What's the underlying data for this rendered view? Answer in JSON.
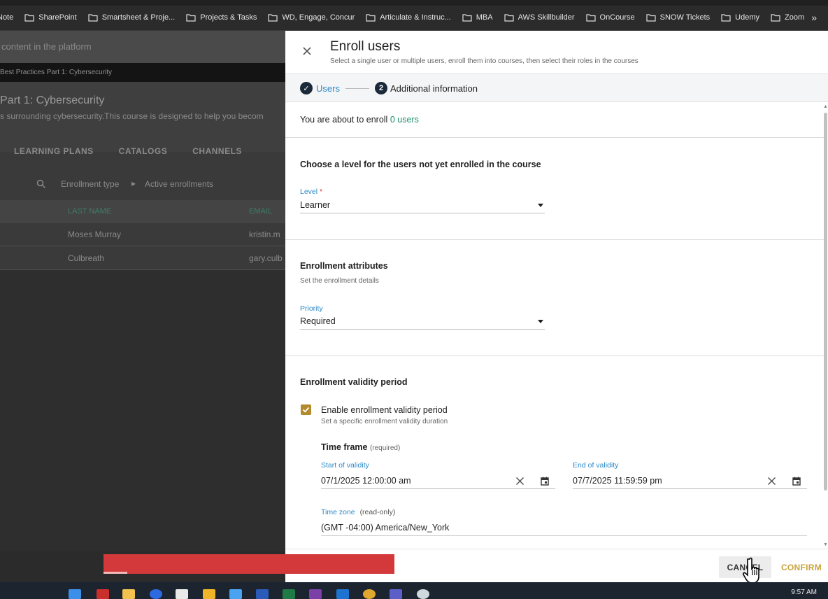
{
  "bookmarks": [
    {
      "label": "Note"
    },
    {
      "label": "SharePoint"
    },
    {
      "label": "Smartsheet & Proje..."
    },
    {
      "label": "Projects & Tasks"
    },
    {
      "label": "WD, Engage, Concur"
    },
    {
      "label": "Articulate & Instruc..."
    },
    {
      "label": "MBA"
    },
    {
      "label": "AWS Skillbuilder"
    },
    {
      "label": "OnCourse"
    },
    {
      "label": "SNOW Tickets"
    },
    {
      "label": "Udemy"
    },
    {
      "label": "Zoom"
    }
  ],
  "bookmarks_more": "»",
  "background": {
    "search_hint": "content in the platform",
    "breadcrumb": "Best Practices Part 1: Cybersecurity",
    "course_title": "Part 1: Cybersecurity",
    "course_desc": "s surrounding cybersecurity.This course is designed to help you becom",
    "tabs": [
      "LEARNING PLANS",
      "CATALOGS",
      "CHANNELS"
    ],
    "filter_type": "Enrollment type",
    "filter_arrow": "▸",
    "filter_value": "Active enrollments",
    "columns": [
      "LAST NAME",
      "EMAIL"
    ],
    "rows": [
      {
        "last_name": "Moses Murray",
        "email": "kristin.m"
      },
      {
        "last_name": "Culbreath",
        "email": "gary.culb"
      }
    ]
  },
  "panel": {
    "title": "Enroll users",
    "subtitle": "Select a single user or multiple users, enroll them into courses, then select their roles in the courses",
    "steps": [
      {
        "number": "✓",
        "label": "Users"
      },
      {
        "number": "2",
        "label": "Additional information"
      }
    ],
    "enroll_prefix": "You are about to enroll",
    "enroll_count": "0 users",
    "level_section_title": "Choose a level for the users not yet enrolled in the course",
    "level_label": "Level",
    "required_mark": "*",
    "level_value": "Learner",
    "attributes_title": "Enrollment attributes",
    "attributes_sub": "Set the enrollment details",
    "priority_label": "Priority",
    "priority_value": "Required",
    "validity_title": "Enrollment validity period",
    "validity_checkbox_label": "Enable enrollment validity period",
    "validity_checkbox_checked": true,
    "validity_checkbox_sub": "Set a specific enrollment validity duration",
    "timeframe_title": "Time frame",
    "timeframe_req": "(required)",
    "start_label": "Start of validity",
    "start_value": "07/1/2025 12:00:00 am",
    "end_label": "End of validity",
    "end_value": "07/7/2025 11:59:59 pm",
    "timezone_label": "Time zone",
    "timezone_readonly": "(read-only)",
    "timezone_value": "(GMT -04:00) America/New_York",
    "cancel_label": "CANCEL",
    "confirm_label": "CONFIRM"
  },
  "colors": {
    "accent_blue": "#2d89c8",
    "count_green": "#1e8e6e",
    "checkbox_gold": "#b38b2f",
    "confirm_gold": "#c9a43b",
    "step_dark": "#1b2a3a",
    "red_bar": "#d3393a"
  },
  "taskbar": {
    "clock": "9:57 AM"
  }
}
